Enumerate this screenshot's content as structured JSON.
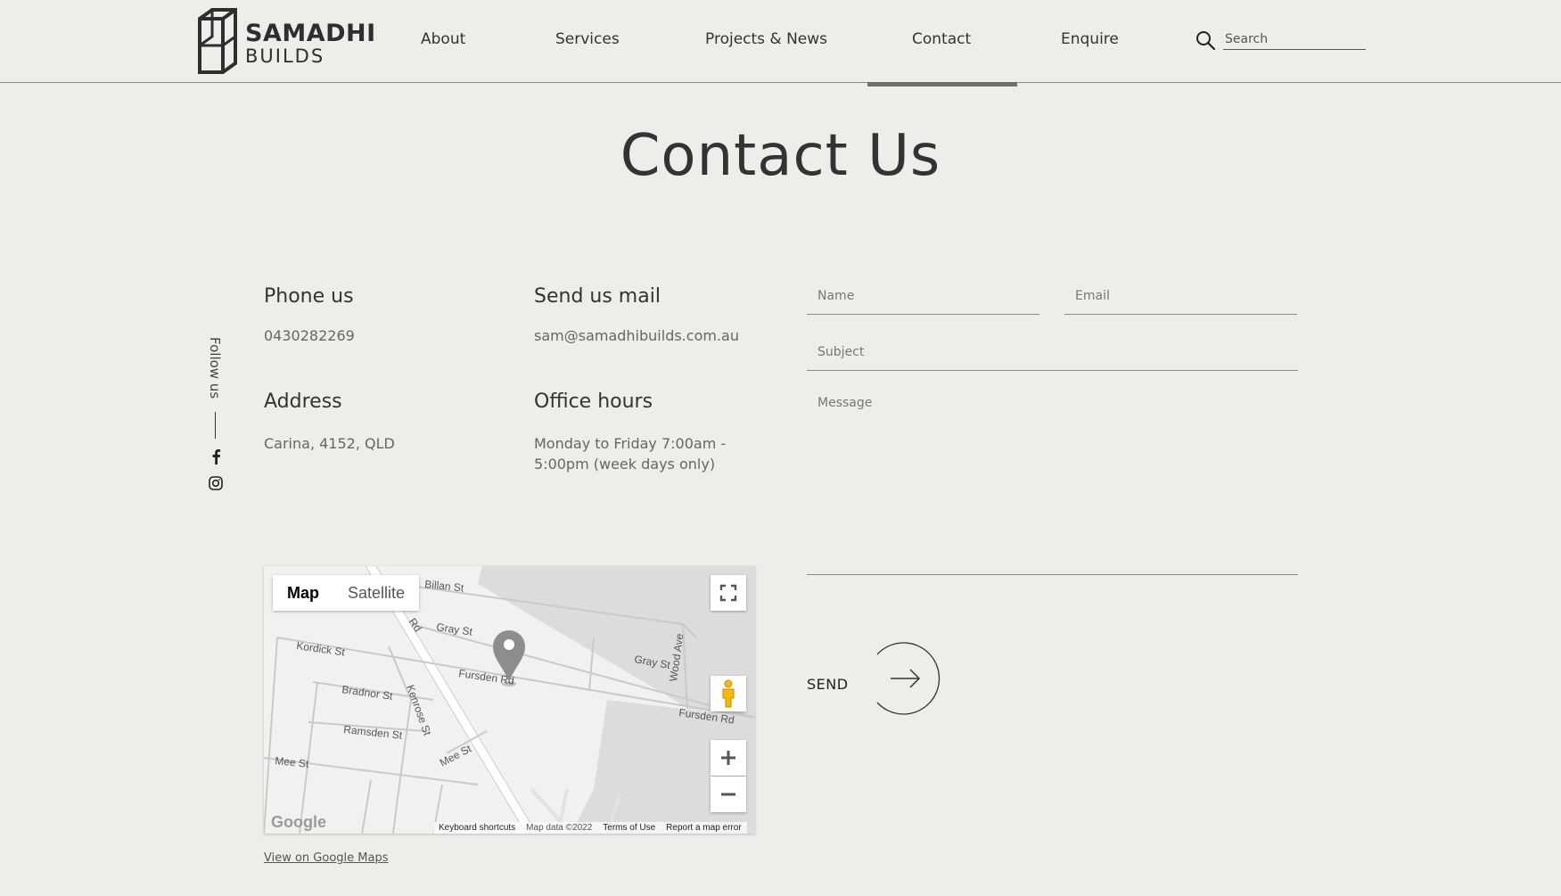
{
  "header": {
    "logo": {
      "line1": "SAMADHI",
      "line2": "BUILDS"
    },
    "nav": [
      {
        "label": "About"
      },
      {
        "label": "Services"
      },
      {
        "label": "Projects & News"
      },
      {
        "label": "Contact"
      },
      {
        "label": "Enquire"
      }
    ],
    "active_nav": "Contact",
    "search": {
      "placeholder": "Search",
      "value": ""
    }
  },
  "page": {
    "title": "Contact Us"
  },
  "social": {
    "label": "Follow us",
    "icons": [
      "facebook-icon",
      "instagram-icon"
    ]
  },
  "contact": {
    "phone": {
      "heading": "Phone us",
      "value": "0430282269"
    },
    "mail": {
      "heading": "Send us mail",
      "value": "sam@samadhibuilds.com.au"
    },
    "address": {
      "heading": "Address",
      "value": "Carina, 4152, QLD"
    },
    "hours": {
      "heading": "Office hours",
      "value": "Monday to Friday 7:00am - 5:00pm (week days only)"
    }
  },
  "form": {
    "name_placeholder": "Name",
    "email_placeholder": "Email",
    "subject_placeholder": "Subject",
    "message_placeholder": "Message",
    "send_label": "SEND"
  },
  "map": {
    "type_buttons": [
      "Map",
      "Satellite"
    ],
    "active_type": "Map",
    "streets": [
      "Billan St",
      "Gray St",
      "Gray St",
      "Kordick St",
      "Fursden Rd",
      "Fursden Rd",
      "Bradnor St",
      "Kenrose St",
      "Wood Ave",
      "Ramsden St",
      "Mee St",
      "Mee St",
      "Rd"
    ],
    "google_logo": "Google",
    "footer": {
      "shortcuts": "Keyboard shortcuts",
      "data": "Map data ©2022",
      "terms": "Terms of Use",
      "report": "Report a map error"
    },
    "view_link": "View on Google Maps"
  }
}
